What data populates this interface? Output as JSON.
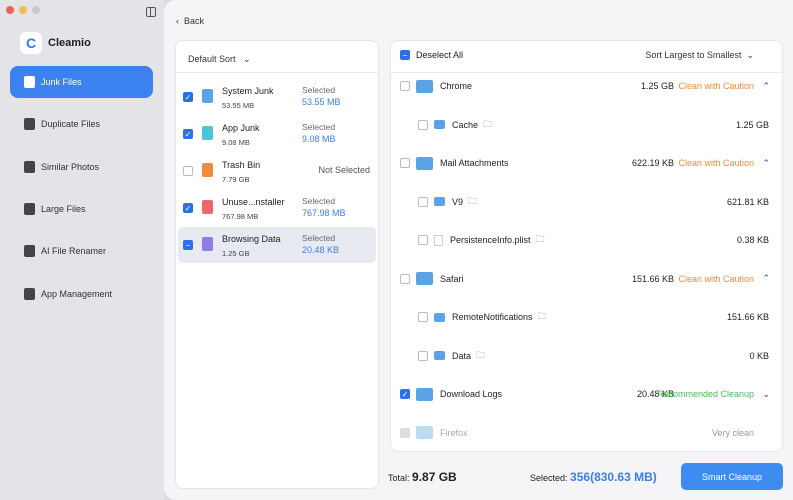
{
  "app": {
    "name": "Cleamio"
  },
  "sidebar": {
    "items": [
      {
        "label": "Junk Files"
      },
      {
        "label": "Duplicate Files"
      },
      {
        "label": "Similar Photos"
      },
      {
        "label": "Large Files"
      },
      {
        "label": "AI File Renamer"
      },
      {
        "label": "App Management"
      }
    ]
  },
  "back_label": "Back",
  "left": {
    "sort": "Default Sort",
    "items": [
      {
        "name": "System Junk",
        "size": "53.55 MB",
        "status": "Selected",
        "selected": "53.55 MB",
        "checked": "on",
        "color": "#5aa3e8"
      },
      {
        "name": "App Junk",
        "size": "9.08 MB",
        "status": "Selected",
        "selected": "9.08 MB",
        "checked": "on",
        "color": "#4cc4d8"
      },
      {
        "name": "Trash Bin",
        "size": "7.79 GB",
        "status": "Not Selected",
        "selected": "",
        "checked": "off",
        "color": "#f08a3c"
      },
      {
        "name": "Unuse...nstaller",
        "size": "767.98 MB",
        "status": "Selected",
        "selected": "767.98 MB",
        "checked": "on",
        "color": "#e86a6a"
      },
      {
        "name": "Browsing Data",
        "size": "1.25 GB",
        "status": "Selected",
        "selected": "20.48 KB",
        "checked": "partial",
        "color": "#8f7be8"
      }
    ]
  },
  "right": {
    "deselect_all": "Deselect All",
    "sort": "Sort Largest to Smallest",
    "rows": [
      {
        "name": "Chrome",
        "size": "1.25 GB",
        "status": "Clean with Caution",
        "level": 0
      },
      {
        "name": "Cache",
        "size": "1.25 GB",
        "level": 1,
        "type": "folder"
      },
      {
        "name": "Mail Attachments",
        "size": "622.19 KB",
        "status": "Clean with Caution",
        "level": 0
      },
      {
        "name": "V9",
        "size": "621.81 KB",
        "level": 1,
        "type": "folder"
      },
      {
        "name": "PersistenceInfo.plist",
        "size": "0.38 KB",
        "level": 1,
        "type": "file"
      },
      {
        "name": "Safari",
        "size": "151.66 KB",
        "status": "Clean with Caution",
        "level": 0
      },
      {
        "name": "RemoteNotifications",
        "size": "151.66 KB",
        "level": 1,
        "type": "folder"
      },
      {
        "name": "Data",
        "size": "0 KB",
        "level": 1,
        "type": "folder"
      },
      {
        "name": "Download Logs",
        "size": "20.48 KB",
        "status": "Recommended Cleanup",
        "level": 0,
        "checked": true
      },
      {
        "name": "Firefox",
        "size": "",
        "status": "Very clean",
        "level": 0,
        "disabled": true
      }
    ]
  },
  "footer": {
    "total_label": "Total:",
    "total": "9.87 GB",
    "selected_label": "Selected:",
    "selected": "356(830.63 MB)",
    "button": "Smart Cleanup"
  },
  "colors": {
    "accent": "#3b82f0",
    "caution": "#f08a3c",
    "recommended": "#4cb85c"
  }
}
